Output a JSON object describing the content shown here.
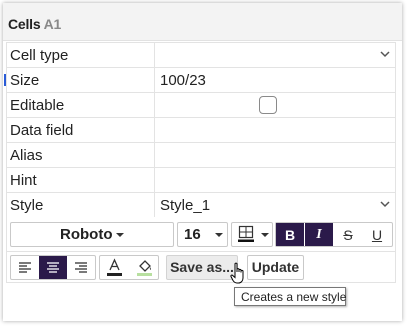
{
  "panel": {
    "title": "Cells",
    "cell_ref": "A1"
  },
  "properties": [
    {
      "label": "Cell type",
      "value": "",
      "control": "dropdown"
    },
    {
      "label": "Size",
      "value": "100/23",
      "control": "text"
    },
    {
      "label": "Editable",
      "value": "",
      "control": "checkbox",
      "checked": false
    },
    {
      "label": "Data field",
      "value": "",
      "control": "text"
    },
    {
      "label": "Alias",
      "value": "",
      "control": "text"
    },
    {
      "label": "Hint",
      "value": "",
      "control": "text"
    },
    {
      "label": "Style",
      "value": "Style_1",
      "control": "dropdown"
    }
  ],
  "toolbar": {
    "font": "Roboto",
    "font_size": "16",
    "bold": {
      "label": "B",
      "active": true
    },
    "italic": {
      "label": "I",
      "active": true
    },
    "strikethrough": {
      "label": "S",
      "active": false
    },
    "underline": {
      "label": "U",
      "active": false
    },
    "align_active": "center",
    "save_as_label": "Save as...",
    "update_label": "Update"
  },
  "tooltip": {
    "text": "Creates a new style"
  },
  "colors": {
    "accent": "#2b1a4a",
    "text_color_swatch": "#222222",
    "fill_color_swatch": "#b8e0a0"
  }
}
